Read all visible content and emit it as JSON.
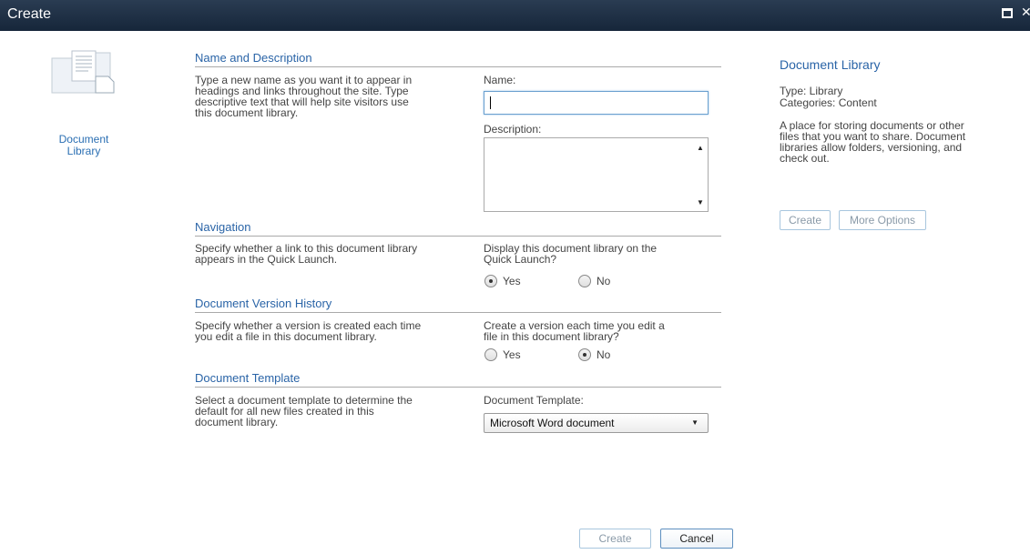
{
  "titlebar": {
    "title": "Create"
  },
  "left_panel": {
    "label_line1": "Document",
    "label_line2": "Library"
  },
  "sections": {
    "name_desc": {
      "title": "Name and Description",
      "desc_lines": [
        "Type a new name as you want it to appear in",
        "headings and links throughout the site. Type",
        "descriptive text that will help site visitors use",
        "this document library."
      ],
      "name_label": "Name:",
      "name_value": "",
      "description_label": "Description:"
    },
    "navigation": {
      "title": "Navigation",
      "desc_lines": [
        "Specify whether a link to this document library",
        "appears in the Quick Launch."
      ],
      "question_lines": [
        "Display this document library on the",
        "Quick Launch?"
      ],
      "yes": "Yes",
      "no": "No",
      "selected": "Yes"
    },
    "version_history": {
      "title": "Document Version History",
      "desc_lines": [
        "Specify whether a version is created each time",
        "you edit a file in this document library."
      ],
      "question_lines": [
        "Create a version each time you edit a",
        "file in this document library?"
      ],
      "yes": "Yes",
      "no": "No",
      "selected": "No"
    },
    "template": {
      "title": "Document Template",
      "desc_lines": [
        "Select a document template to determine the",
        "default for all new files created in this",
        "document library."
      ],
      "label": "Document Template:",
      "selected": "Microsoft Word document"
    }
  },
  "side_panel": {
    "title": "Document Library",
    "type": "Type: Library",
    "categories": "Categories: Content",
    "desc_lines": [
      "A place for storing documents or other",
      "files that you want to share. Document",
      "libraries allow folders, versioning, and",
      "check out."
    ],
    "create_label": "Create",
    "more_options_label": "More Options"
  },
  "footer": {
    "create_label": "Create",
    "cancel_label": "Cancel"
  }
}
